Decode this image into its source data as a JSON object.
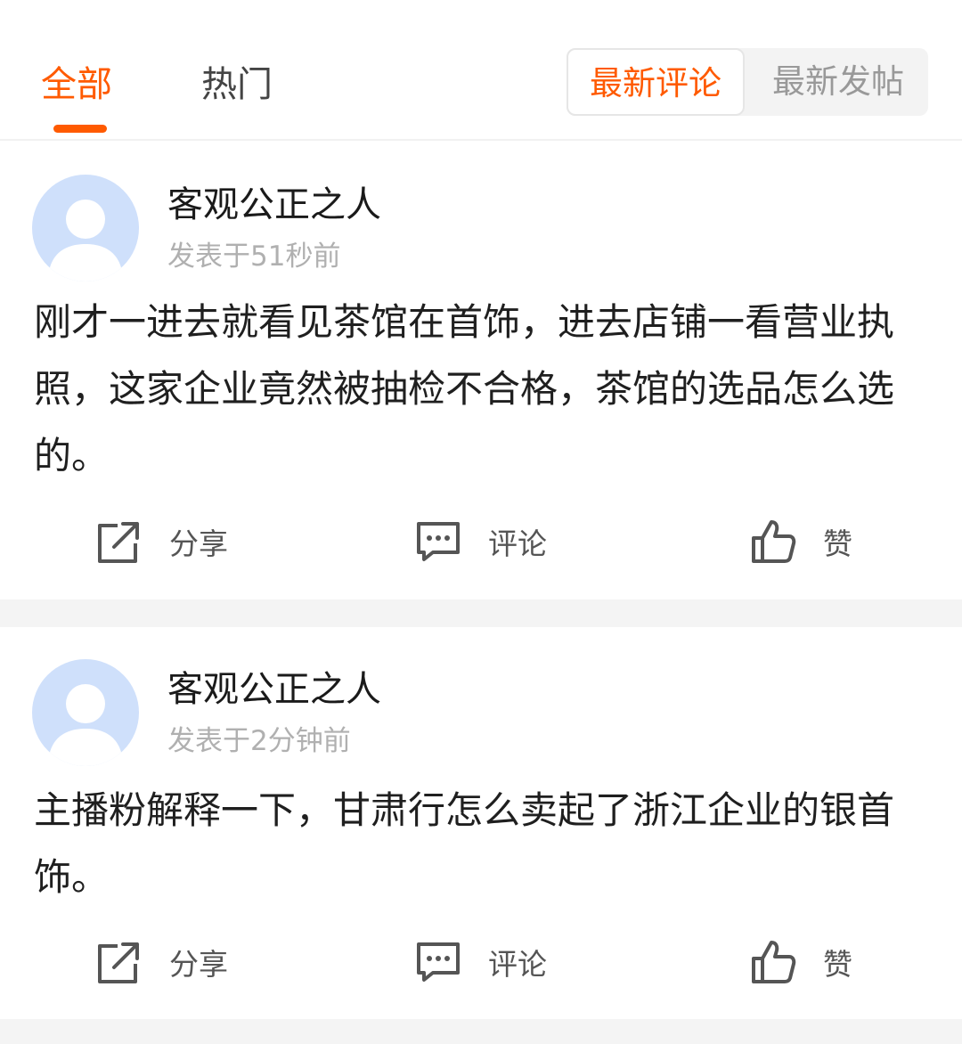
{
  "tabs": {
    "all": "全部",
    "hot": "热门"
  },
  "sort": {
    "latest_comment": "最新评论",
    "latest_post": "最新发帖"
  },
  "posts": [
    {
      "username": "客观公正之人",
      "time": "发表于51秒前",
      "content": "刚才一进去就看见茶馆在首饰，进去店铺一看营业执照，这家企业竟然被抽检不合格，茶馆的选品怎么选的。",
      "actions": {
        "share": "分享",
        "comment": "评论",
        "like": "赞"
      }
    },
    {
      "username": "客观公正之人",
      "time": "发表于2分钟前",
      "content": "主播粉解释一下，甘肃行怎么卖起了浙江企业的银首饰。",
      "actions": {
        "share": "分享",
        "comment": "评论",
        "like": "赞"
      }
    }
  ],
  "colors": {
    "accent": "#ff5a00",
    "avatar_bg": "#cfe0fb",
    "avatar_fg": "#ffffff",
    "icon": "#555555",
    "divider": "#f4f4f4"
  },
  "icons": [
    "avatar-placeholder-icon",
    "share-icon",
    "comment-icon",
    "thumbs-up-icon"
  ]
}
